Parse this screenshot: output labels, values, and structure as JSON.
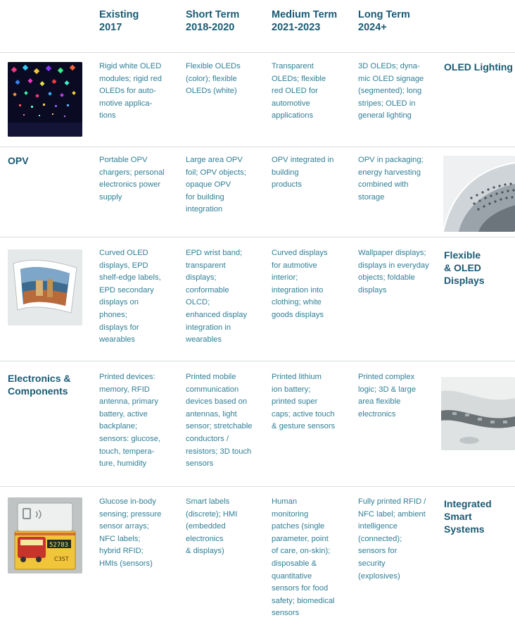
{
  "columns": [
    {
      "name": "Existing",
      "period": "2017"
    },
    {
      "name": "Short Term",
      "period": "2018-2020"
    },
    {
      "name": "Medium Term",
      "period": "2021-2023"
    },
    {
      "name": "Long Term",
      "period": "2024+"
    }
  ],
  "rows": [
    {
      "label": "OLED Lighting",
      "cells": [
        "Rigid white OLED\nmodules; rigid red\nOLEDs for auto-\nmotive applica-\ntions",
        "Flexible OLEDs\n(color); flexible\nOLEDs (white)",
        "Transparent\nOLEDs; flexible\nred OLED for\nautomotive\napplications",
        "3D OLEDs; dyna-\nmic OLED signage\n(segmented); long\nstripes; OLED in\ngeneral lighting"
      ]
    },
    {
      "label": "OPV",
      "cells": [
        "Portable OPV\nchargers; personal\nelectronics power\nsupply",
        "Large area OPV\nfoil; OPV objects;\nopaque OPV\nfor building\nintegration",
        "OPV integrated in\nbuilding\nproducts",
        "OPV in packaging;\nenergy harvesting\ncombined with\nstorage"
      ]
    },
    {
      "label": "Flexible\n& OLED\nDisplays",
      "cells": [
        "Curved OLED\ndisplays, EPD\nshelf-edge labels,\nEPD secondary\ndisplays on\nphones;\ndisplays for\nwearables",
        "EPD wrist band;\ntransparent\ndisplays;\nconformable\nOLCD;\nenhanced display\nintegration in\nwearables",
        "Curved displays\nfor autmotive\ninterior;\nintegration into\nclothing; white\ngoods displays",
        "Wallpaper displays;\ndisplays in everyday\nobjects; foldable\ndisplays"
      ]
    },
    {
      "label": "Electronics &\nComponents",
      "cells": [
        "Printed devices:\nmemory, RFID\nantenna, primary\nbattery, active\nbackplane;\nsensors: glucose,\ntouch, tempera-\nture, humidity",
        "Printed mobile\ncommunication\ndevices based on\nantennas, light\nsensor; stretchable\nconductors /\nresistors; 3D touch\nsensors",
        "Printed lithium\nion battery;\nprinted super\ncaps; active touch\n& gesture sensors",
        "Printed complex\nlogic; 3D & large\narea flexible\nelectronics"
      ]
    },
    {
      "label": "Integrated\nSmart\nSystems",
      "cells": [
        "Glucose in-body\nsensing; pressure\nsensor arrays;\nNFC labels;\nhybrid RFID;\nHMIs (sensors)",
        "Smart labels\n(discrete); HMI\n(embedded\nelectronics\n& displays)",
        "Human\nmonitoring\npatches (single\nparameter, point\nof care, on-skin);\ndisposable &\nquantitative\nsensors for food\nsafety; biomedical\nsensors",
        "Fully printed RFID /\nNFC label; ambient\nintelligence\n(connected);\nsensors for\nsecurity\n(explosives)"
      ]
    }
  ],
  "images": {
    "ticket_text_1": "52783",
    "ticket_text_2": "C3ST"
  },
  "colors": {
    "header": "#1a5a73",
    "body_text": "#2f7f96",
    "rule": "#d7dde0"
  }
}
